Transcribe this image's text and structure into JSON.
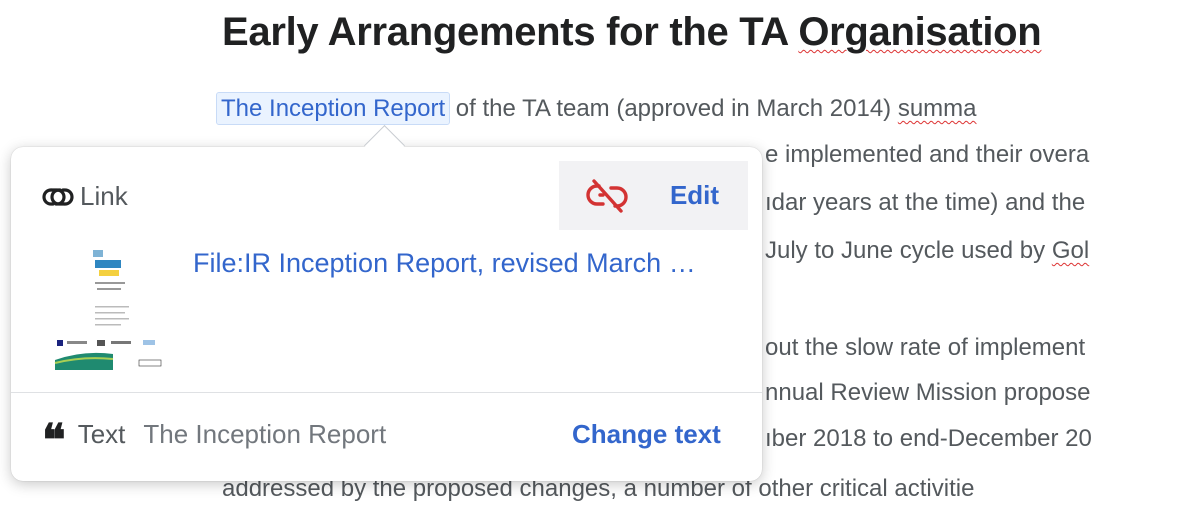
{
  "article": {
    "heading_prefix": "Early Arrangements for the TA ",
    "heading_misspelled": "Organisation",
    "link_text": "The Inception Report",
    "line1_rest": " of the TA team (approved in March 2014) ",
    "line1_misspelled": "summa",
    "line2": "e implemented and their overa",
    "line3": "ıdar years at the time) and the",
    "line4_prefix": "July to June cycle used by ",
    "line4_misspelled": "Gol",
    "line5": "out the slow rate of implement",
    "line6": "nnual Review Mission propose",
    "line7": "ıber 2018 to end-December 20",
    "line8": "addressed by the proposed changes, a number of other critical activitie"
  },
  "popup": {
    "type_label": "Link",
    "edit_label": "Edit",
    "file_link": "File:IR Inception Report, revised March …",
    "text_label": "Text",
    "text_value": "The Inception Report",
    "change_text_label": "Change text",
    "link_icon": "link-icon",
    "unlink_icon": "unlink-icon",
    "quote_icon": "quote-icon"
  },
  "colors": {
    "link": "#3366cc",
    "unlink": "#d33333",
    "spellcheck": "#dd3333"
  }
}
